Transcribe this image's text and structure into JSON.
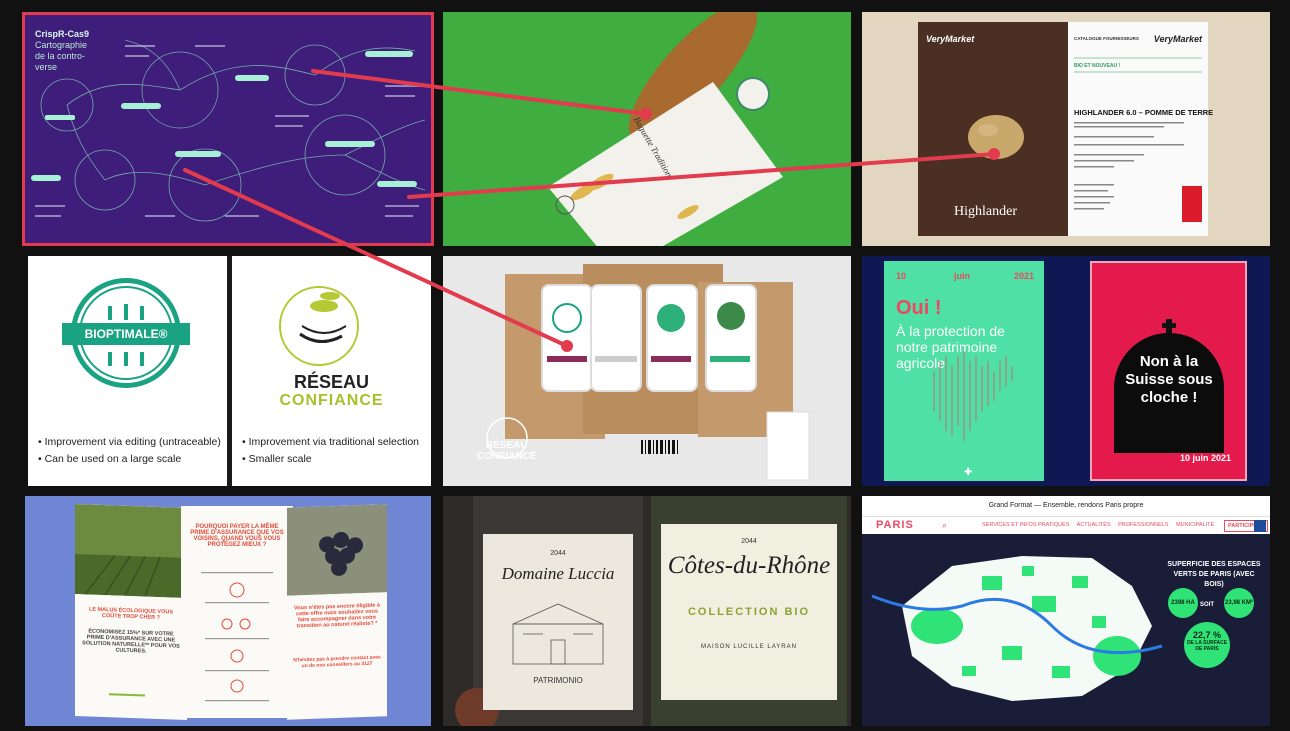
{
  "mindmap": {
    "title_line1": "CrispR-Cas9",
    "title_line2": "Cartographie",
    "title_line3": "de la contro-",
    "title_line4": "verse"
  },
  "baguette": {
    "bag_text": "Baguette Tradition"
  },
  "catalog": {
    "left_logo": "VeryMarket",
    "right_logo": "VeryMarket",
    "header": "CATALOGUE FOURNISSEURS",
    "bio_badge": "BIO ET NOUVEAU !",
    "headline": "HIGHLANDER 6.0 – POMME DE TERRE",
    "brand": "Highlander"
  },
  "logos": {
    "left": {
      "badge_label": "BIOPTIMALE®",
      "bullets": [
        "Improvement via editing (untraceable)",
        "Can be used on a large scale"
      ]
    },
    "right": {
      "title": "RÉSEAU",
      "subtitle": "CONFIANCE",
      "bullets": [
        "Improvement via traditional selection",
        "Smaller scale"
      ]
    }
  },
  "pack": {
    "mark_line1": "RÉSEAU",
    "mark_line2": "CONFIANCE"
  },
  "posters": {
    "green": {
      "date_day": "10",
      "date_month": "juin",
      "date_year": "2021",
      "oui": "Oui !",
      "text": "À la protection de notre patrimoine agricole"
    },
    "red": {
      "text": "Non à la Suisse sous cloche !",
      "date": "10 juin 2021"
    }
  },
  "brochure": {
    "heading_top": "POURQUOI PAYER LA MÊME PRIME D'ASSURANCE QUE VOS VOISINS, QUAND VOUS VOUS PROTÉGEZ MIEUX ?",
    "heading_left": "LE MALUS ÉCOLOGIQUE VOUS COÛTE TROP CHER ?",
    "sub_left": "ÉCONOMISEZ 15%* SUR VOTRE PRIME D'ASSURANCE AVEC UNE SOLUTION NATURELLE** POUR VOS CULTURES.",
    "heading_right": "Vous n'êtes pas encore éligible à cette offre mais souhaitez vous faire accompagner dans votre transition au naturel réaliste? *",
    "contact": "N'hésitez pas à prendre contact avec un de nos conseillers au 3127"
  },
  "wine": {
    "a_year": "2044",
    "a_name": "Domaine Luccia",
    "a_patrimonio": "PATRIMONIO",
    "b_year": "2044",
    "b_name": "Côtes-du-Rhône",
    "b_collection": "COLLECTION BIO",
    "b_maison": "MAISON LUCILLE LAYRAN"
  },
  "paris": {
    "top_banner": "Grand Format — Ensemble, rendons Paris propre",
    "logo": "PARIS",
    "menu": [
      "SERVICES ET INFOS PRATIQUES",
      "ACTUALITÉS",
      "PROFESSIONNELS",
      "MUNICIPALITÉ"
    ],
    "participate": "PARTICIPEZ !",
    "superficie": "SUPERFICIE DES ESPACES VERTS DE PARIS (AVEC BOIS)",
    "stat_ha": "2398 HA",
    "stat_km": "23,98 KM²",
    "soit": "SOIT",
    "stat_pct": "22,7 %",
    "stat_pct_sub": "DE LA SURFACE DE PARIS"
  },
  "colors": {
    "connector": "#e23b4e",
    "mindmap_bg": "#3f1d7a",
    "green_poster": "#4fe0a6",
    "red_poster": "#e51a4c"
  }
}
